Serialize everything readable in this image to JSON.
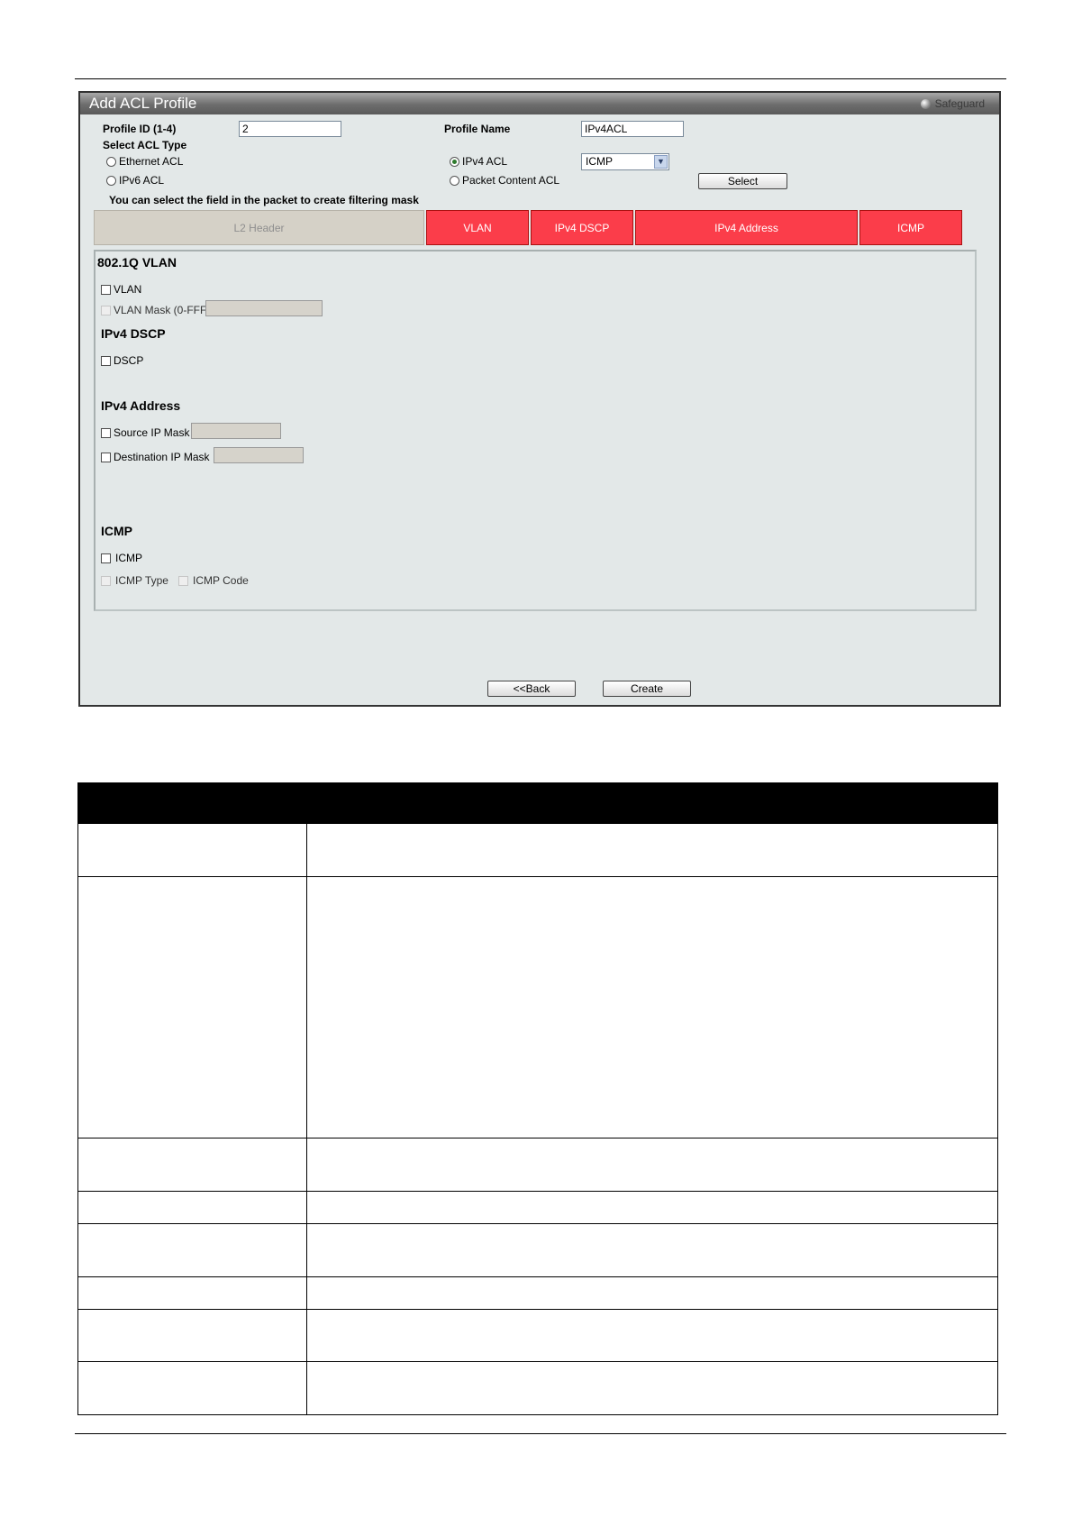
{
  "panel": {
    "title": "Add ACL Profile",
    "safeguard_label": "Safeguard"
  },
  "form": {
    "profile_id_label": "Profile ID (1-4)",
    "profile_id_value": "2",
    "profile_name_label": "Profile Name",
    "profile_name_value": "IPv4ACL",
    "acl_type_label": "Select ACL Type",
    "acl_types": [
      {
        "label": "Ethernet ACL",
        "selected": false
      },
      {
        "label": "IPv6 ACL",
        "selected": false
      },
      {
        "label": "IPv4 ACL",
        "selected": true
      },
      {
        "label": "Packet Content ACL",
        "selected": false
      }
    ],
    "protocol_select_value": "ICMP",
    "select_button_label": "Select",
    "hint": "You can select the field in the packet to create filtering mask"
  },
  "tabs": [
    {
      "label": "L2 Header",
      "active": false
    },
    {
      "label": "VLAN",
      "active": true
    },
    {
      "label": "IPv4 DSCP",
      "active": true
    },
    {
      "label": "IPv4 Address",
      "active": true
    },
    {
      "label": "ICMP",
      "active": true
    }
  ],
  "sections": {
    "vlan_title": "802.1Q VLAN",
    "vlan_cb": "VLAN",
    "vlan_mask": "VLAN Mask (0-FFF)",
    "dscp_title": "IPv4 DSCP",
    "dscp_cb": "DSCP",
    "ipv4_title": "IPv4 Address",
    "src_ip_mask": "Source IP Mask",
    "dst_ip_mask": "Destination IP Mask",
    "icmp_title": "ICMP",
    "icmp_cb": "ICMP",
    "icmp_type": "ICMP Type",
    "icmp_code": "ICMP Code"
  },
  "buttons": {
    "back": "<<Back",
    "create": "Create"
  },
  "colors": {
    "tab_active": "#fb3d4a",
    "tab_inactive": "#d5d1c7",
    "panel_bg": "#e3e8e8",
    "radio_selected": "#2d7a2d"
  }
}
